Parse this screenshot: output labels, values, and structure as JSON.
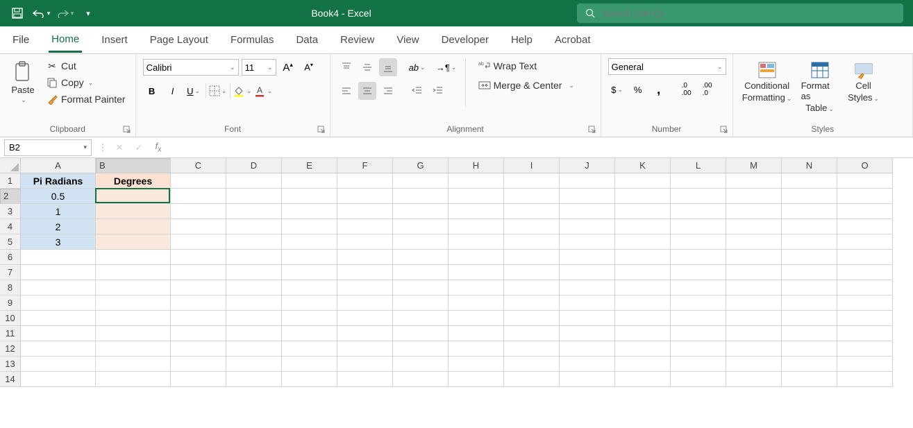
{
  "title": "Book4  -  Excel",
  "search": {
    "placeholder": "Search (Alt+Q)"
  },
  "tabs": [
    "File",
    "Home",
    "Insert",
    "Page Layout",
    "Formulas",
    "Data",
    "Review",
    "View",
    "Developer",
    "Help",
    "Acrobat"
  ],
  "active_tab": "Home",
  "ribbon": {
    "clipboard": {
      "paste": "Paste",
      "cut": "Cut",
      "copy": "Copy",
      "format_painter": "Format Painter",
      "label": "Clipboard"
    },
    "font": {
      "name": "Calibri",
      "size": "11",
      "label": "Font"
    },
    "alignment": {
      "wrap": "Wrap Text",
      "merge": "Merge & Center",
      "label": "Alignment"
    },
    "number": {
      "format": "General",
      "label": "Number"
    },
    "styles": {
      "cond": "Conditional",
      "cond2": "Formatting",
      "table": "Format as",
      "table2": "Table",
      "cell": "Cell",
      "cell2": "Styles",
      "label": "Styles"
    }
  },
  "namebox": "B2",
  "formula": "",
  "columns": [
    "A",
    "B",
    "C",
    "D",
    "E",
    "F",
    "G",
    "H",
    "I",
    "J",
    "K",
    "L",
    "M",
    "N",
    "O"
  ],
  "wide_cols": [
    "A",
    "B"
  ],
  "rows": [
    "1",
    "2",
    "3",
    "4",
    "5",
    "6",
    "7",
    "8",
    "9",
    "10",
    "11",
    "12",
    "13",
    "14"
  ],
  "cells": {
    "A1": "Pi Radians",
    "B1": "Degrees",
    "A2": "0.5",
    "A3": "1",
    "A4": "2",
    "A5": "3"
  },
  "styles": {
    "A1": "hblue",
    "B1": "horange",
    "A2": "lblue",
    "A3": "lblue",
    "A4": "lblue",
    "A5": "lblue",
    "B2": "lorange",
    "B3": "lorange",
    "B4": "lorange",
    "B5": "lorange"
  },
  "active_cell": "B2",
  "active_col": "B",
  "active_row": "2"
}
